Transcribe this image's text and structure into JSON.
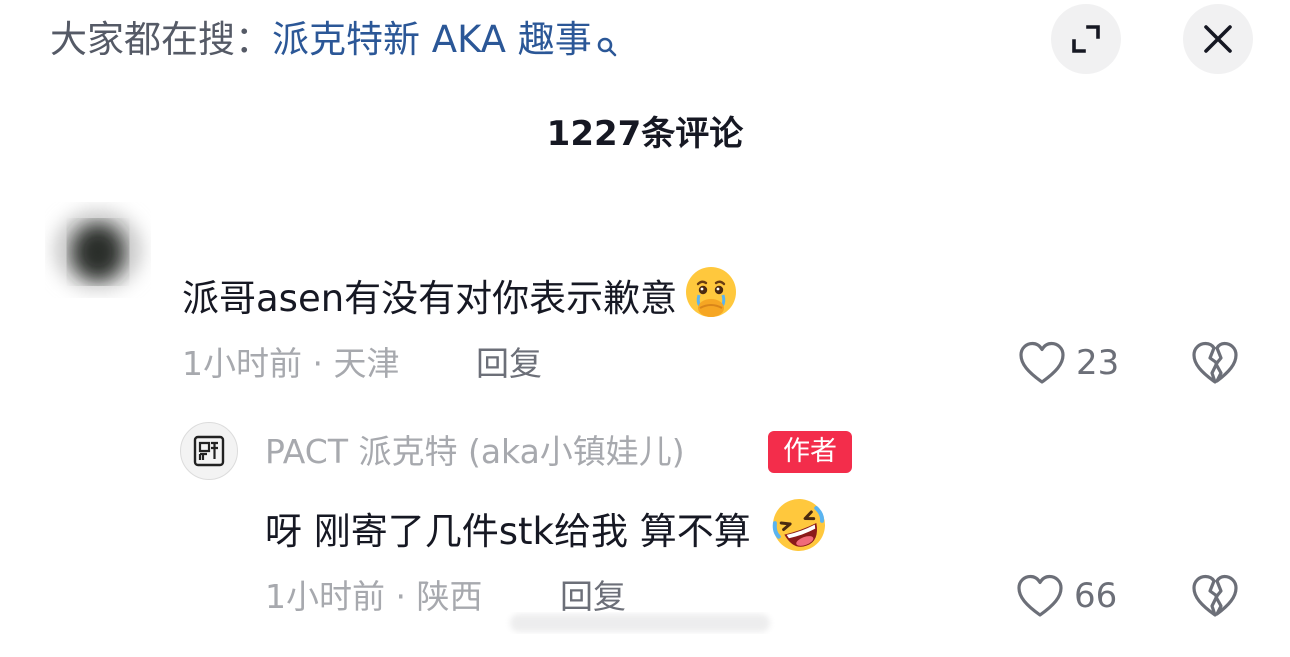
{
  "header": {
    "search_prefix": "大家都在搜：",
    "search_topic": "派克特新 AKA 趣事"
  },
  "comments_title": "1227条评论",
  "comment": {
    "text": "派哥asen有没有对你表示歉意",
    "emoji": "crying-face-emoji",
    "meta": "1小时前 · 天津",
    "reply_label": "回复",
    "likes": "23"
  },
  "reply": {
    "author": "PACT 派克特 (aka小镇娃儿)",
    "badge": "作者",
    "text": "呀 刚寄了几件stk给我 算不算",
    "emoji": "rolling-laughing-emoji",
    "meta": "1小时前 · 陕西",
    "reply_label": "回复",
    "likes": "66"
  },
  "colors": {
    "topic_blue": "#2b5797",
    "badge_red": "#f32d4b",
    "meta_gray": "#a7a9ae"
  }
}
